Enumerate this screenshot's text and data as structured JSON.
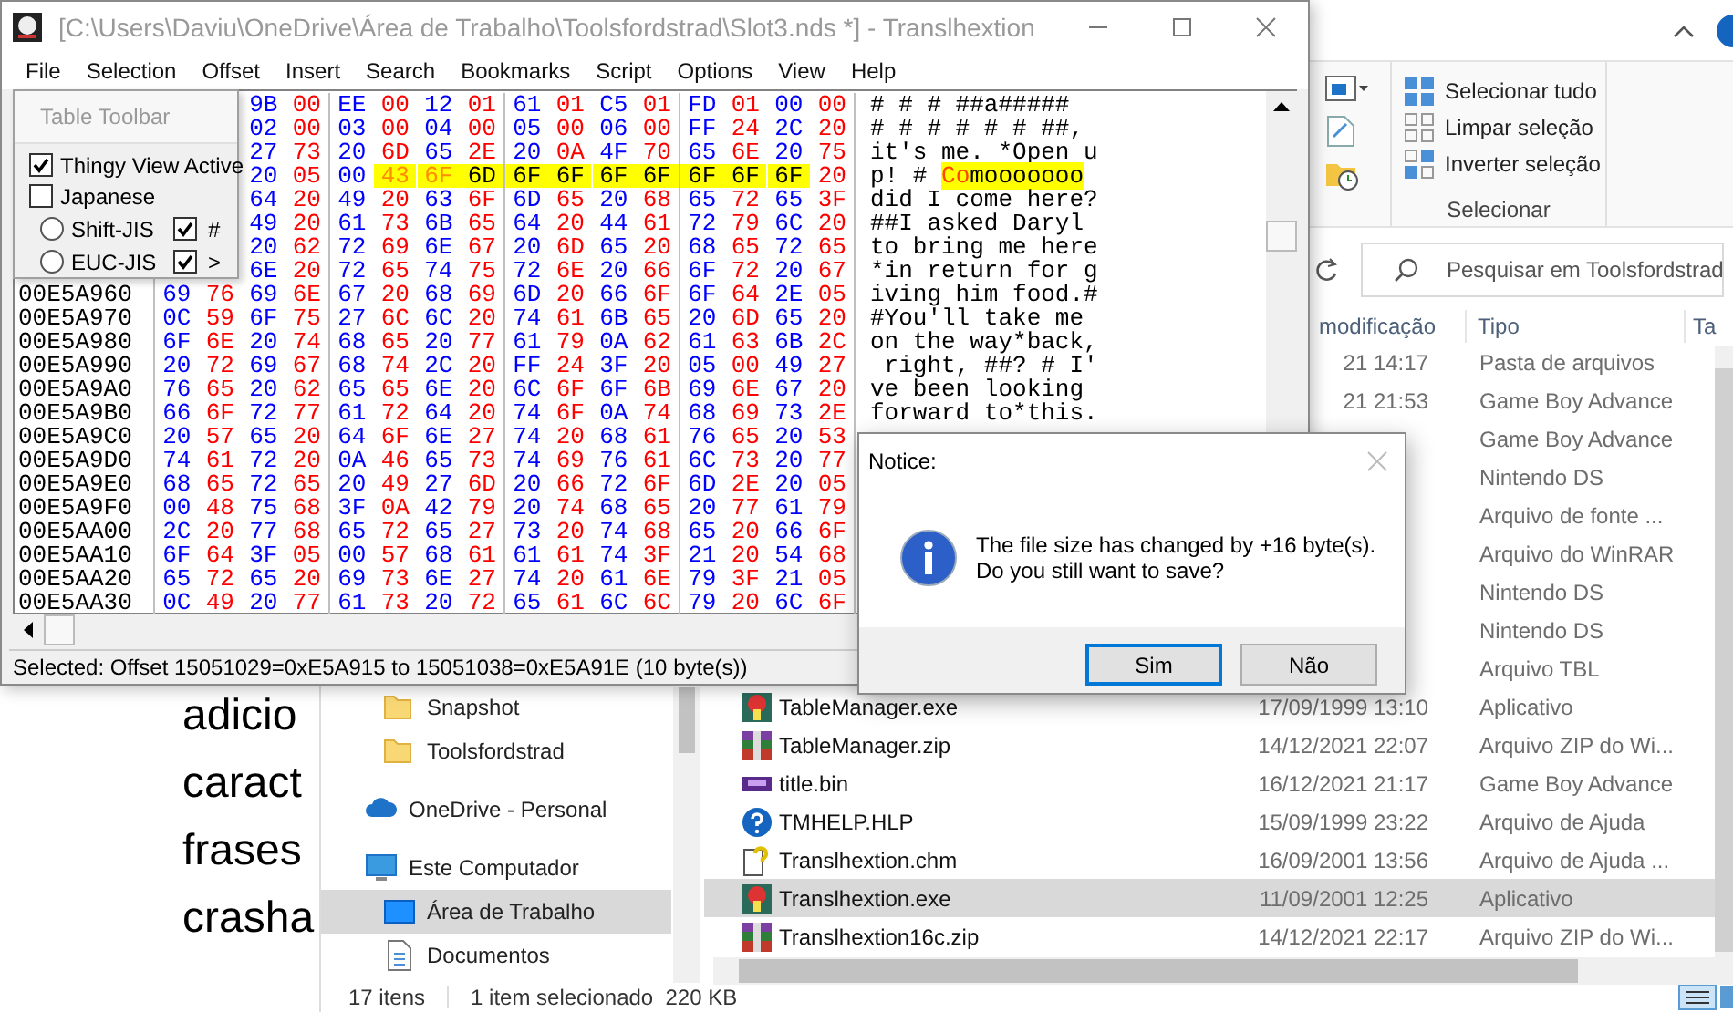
{
  "background_document": {
    "lines": [
      "adicio",
      "caract",
      "frases",
      "crasha"
    ]
  },
  "explorer": {
    "ribbon": {
      "select_group": {
        "items": [
          "Selecionar tudo",
          "Limpar seleção",
          "Inverter seleção"
        ],
        "label": "Selecionar"
      }
    },
    "search": {
      "placeholder": "Pesquisar em Toolsfordstrad"
    },
    "columns": [
      "modificação",
      "Tipo",
      "Ta"
    ],
    "files": [
      {
        "date": "21 14:17",
        "type": "Pasta de arquivos",
        "selected": false
      },
      {
        "date": "21 21:53",
        "type": "Game Boy Advance",
        "selected": false
      },
      {
        "type": "Game Boy Advance",
        "selected": false
      },
      {
        "type": "Nintendo DS",
        "selected": false
      },
      {
        "type": "Arquivo de fonte ...",
        "selected": false
      },
      {
        "type": "Arquivo do WinRAR",
        "selected": false
      },
      {
        "type": "Nintendo DS",
        "selected": false
      },
      {
        "type": "Nintendo DS",
        "selected": false
      },
      {
        "type": "Arquivo TBL",
        "selected": false
      },
      {
        "kind": "app",
        "name": "TableManager.exe",
        "date": "17/09/1999 13:10",
        "type": "Aplicativo",
        "selected": false
      },
      {
        "kind": "zip",
        "name": "TableManager.zip",
        "date": "14/12/2021 22:07",
        "type": "Arquivo ZIP do Wi...",
        "selected": false
      },
      {
        "kind": "rom",
        "name": "title.bin",
        "date": "16/12/2021 21:17",
        "type": "Game Boy Advance",
        "selected": false
      },
      {
        "kind": "help",
        "name": "TMHELP.HLP",
        "date": "15/09/1999 23:22",
        "type": "Arquivo de Ajuda",
        "selected": false
      },
      {
        "kind": "chm",
        "name": "Translhextion.chm",
        "date": "16/09/2001 13:56",
        "type": "Arquivo de Ajuda ...",
        "selected": false
      },
      {
        "kind": "app",
        "name": "Translhextion.exe",
        "date": "11/09/2001 12:25",
        "type": "Aplicativo",
        "selected": true
      },
      {
        "kind": "zip",
        "name": "Translhextion16c.zip",
        "date": "14/12/2021 22:17",
        "type": "Arquivo ZIP do Wi...",
        "selected": false
      }
    ],
    "nav": [
      {
        "kind": "folder",
        "label": "Snapshot",
        "selected": false
      },
      {
        "kind": "folder",
        "label": "Toolsfordstrad",
        "selected": false
      },
      {
        "kind": "cloud",
        "label": "OneDrive - Personal",
        "selected": false
      },
      {
        "kind": "computer",
        "label": "Este Computador",
        "selected": false
      },
      {
        "kind": "desktop",
        "label": "Área de Trabalho",
        "selected": true
      },
      {
        "kind": "documents",
        "label": "Documentos",
        "selected": false
      }
    ],
    "status": [
      "17 itens",
      "1 item selecionado  220 KB"
    ]
  },
  "editor": {
    "title": "[C:\\Users\\Daviu\\OneDrive\\Área de Trabalho\\Toolsfordstrad\\Slot3.nds *] - Translhextion",
    "menu": [
      "File",
      "Selection",
      "Offset",
      "Insert",
      "Search",
      "Bookmarks",
      "Script",
      "Options",
      "View",
      "Help"
    ],
    "table_toolbar": {
      "title": "Table Toolbar",
      "options": [
        {
          "kind": "checkbox",
          "label": "Thingy View Active",
          "checked": true
        },
        {
          "kind": "checkbox",
          "label": "Japanese",
          "checked": false
        },
        {
          "kind": "radio",
          "label": "Shift-JIS",
          "selected": false,
          "flag": {
            "label": "#",
            "checked": true
          }
        },
        {
          "kind": "radio",
          "label": "EUC-JIS",
          "selected": false,
          "flag": {
            "label": ">",
            "checked": true
          }
        }
      ]
    },
    "rows": [
      {
        "bytes": [
          "9B",
          "00",
          "EE",
          "00",
          "12",
          "01",
          "61",
          "01",
          "C5",
          "01",
          "FD",
          "01",
          "00",
          "00"
        ],
        "text": "# # # ##a#####"
      },
      {
        "bytes": [
          "02",
          "00",
          "03",
          "00",
          "04",
          "00",
          "05",
          "00",
          "06",
          "00",
          "FF",
          "24",
          "2C",
          "20"
        ],
        "text": "# # # # # # ##,"
      },
      {
        "bytes": [
          "27",
          "73",
          "20",
          "6D",
          "65",
          "2E",
          "20",
          "0A",
          "4F",
          "70",
          "65",
          "6E",
          "20",
          "75"
        ],
        "text": "it's me. *Open u"
      },
      {
        "bytes": [
          "20",
          "05",
          "00",
          {
            "hex": "43",
            "selected": true,
            "modified": true
          },
          {
            "hex": "6F",
            "selected": true,
            "modified": true
          },
          {
            "hex": "6D",
            "selected": true,
            "modified": false
          },
          {
            "hex": "6F",
            "selected": true,
            "modified": false
          },
          {
            "hex": "6F",
            "selected": true,
            "modified": false
          },
          {
            "hex": "6F",
            "selected": true,
            "modified": false
          },
          {
            "hex": "6F",
            "selected": true,
            "modified": false
          },
          {
            "hex": "6F",
            "selected": true,
            "modified": false
          },
          {
            "hex": "6F",
            "selected": true,
            "modified": false
          },
          {
            "hex": "6F",
            "selected": true,
            "modified": false
          },
          "20"
        ],
        "text": [
          {
            "text": "p! # ",
            "selected": false,
            "modified": false
          },
          {
            "text": "Co",
            "selected": true,
            "modified": true
          },
          {
            "text": "mooooooo",
            "selected": true,
            "modified": false
          }
        ]
      },
      {
        "bytes": [
          "64",
          "20",
          "49",
          "20",
          "63",
          "6F",
          "6D",
          "65",
          "20",
          "68",
          "65",
          "72",
          "65",
          "3F"
        ],
        "text": "did I come here?"
      },
      {
        "bytes": [
          "49",
          "20",
          "61",
          "73",
          "6B",
          "65",
          "64",
          "20",
          "44",
          "61",
          "72",
          "79",
          "6C",
          "20"
        ],
        "text": "##I asked Daryl"
      },
      {
        "bytes": [
          "20",
          "62",
          "72",
          "69",
          "6E",
          "67",
          "20",
          "6D",
          "65",
          "20",
          "68",
          "65",
          "72",
          "65"
        ],
        "text": "to bring me here"
      },
      {
        "bytes": [
          "6E",
          "20",
          "72",
          "65",
          "74",
          "75",
          "72",
          "6E",
          "20",
          "66",
          "6F",
          "72",
          "20",
          "67"
        ],
        "text": "*in return for g"
      },
      {
        "offset": "00E5A960",
        "bytes": [
          "69",
          "76",
          "69",
          "6E",
          "67",
          "20",
          "68",
          "69",
          "6D",
          "20",
          "66",
          "6F",
          "6F",
          "64",
          "2E",
          "05"
        ],
        "text": "iving him food.#"
      },
      {
        "offset": "00E5A970",
        "bytes": [
          "0C",
          "59",
          "6F",
          "75",
          "27",
          "6C",
          "6C",
          "20",
          "74",
          "61",
          "6B",
          "65",
          "20",
          "6D",
          "65",
          "20"
        ],
        "text": "#You'll take me"
      },
      {
        "offset": "00E5A980",
        "bytes": [
          "6F",
          "6E",
          "20",
          "74",
          "68",
          "65",
          "20",
          "77",
          "61",
          "79",
          "0A",
          "62",
          "61",
          "63",
          "6B",
          "2C"
        ],
        "text": "on the way*back,"
      },
      {
        "offset": "00E5A990",
        "bytes": [
          "20",
          "72",
          "69",
          "67",
          "68",
          "74",
          "2C",
          "20",
          "FF",
          "24",
          "3F",
          "20",
          "05",
          "00",
          "49",
          "27"
        ],
        "text": " right, ##? # I'"
      },
      {
        "offset": "00E5A9A0",
        "bytes": [
          "76",
          "65",
          "20",
          "62",
          "65",
          "65",
          "6E",
          "20",
          "6C",
          "6F",
          "6F",
          "6B",
          "69",
          "6E",
          "67",
          "20"
        ],
        "text": "ve been looking"
      },
      {
        "offset": "00E5A9B0",
        "bytes": [
          "66",
          "6F",
          "72",
          "77",
          "61",
          "72",
          "64",
          "20",
          "74",
          "6F",
          "0A",
          "74",
          "68",
          "69",
          "73",
          "2E"
        ],
        "text": "forward to*this."
      },
      {
        "offset": "00E5A9C0",
        "bytes": [
          "20",
          "57",
          "65",
          "20",
          "64",
          "6F",
          "6E",
          "27",
          "74",
          "20",
          "68",
          "61",
          "76",
          "65",
          "20",
          "53"
        ]
      },
      {
        "offset": "00E5A9D0",
        "bytes": [
          "74",
          "61",
          "72",
          "20",
          "0A",
          "46",
          "65",
          "73",
          "74",
          "69",
          "76",
          "61",
          "6C",
          "73",
          "20",
          "77"
        ]
      },
      {
        "offset": "00E5A9E0",
        "bytes": [
          "68",
          "65",
          "72",
          "65",
          "20",
          "49",
          "27",
          "6D",
          "20",
          "66",
          "72",
          "6F",
          "6D",
          "2E",
          "20",
          "05"
        ]
      },
      {
        "offset": "00E5A9F0",
        "bytes": [
          "00",
          "48",
          "75",
          "68",
          "3F",
          "0A",
          "42",
          "79",
          "20",
          "74",
          "68",
          "65",
          "20",
          "77",
          "61",
          "79"
        ]
      },
      {
        "offset": "00E5AA00",
        "bytes": [
          "2C",
          "20",
          "77",
          "68",
          "65",
          "72",
          "65",
          "27",
          "73",
          "20",
          "74",
          "68",
          "65",
          "20",
          "66",
          "6F"
        ]
      },
      {
        "offset": "00E5AA10",
        "bytes": [
          "6F",
          "64",
          "3F",
          "05",
          "00",
          "57",
          "68",
          "61",
          "61",
          "61",
          "74",
          "3F",
          "21",
          "20",
          "54",
          "68"
        ]
      },
      {
        "offset": "00E5AA20",
        "bytes": [
          "65",
          "72",
          "65",
          "20",
          "69",
          "73",
          "6E",
          "27",
          "74",
          "20",
          "61",
          "6E",
          "79",
          "3F",
          "21",
          "05"
        ]
      },
      {
        "offset": "00E5AA30",
        "bytes": [
          "0C",
          "49",
          "20",
          "77",
          "61",
          "73",
          "20",
          "72",
          "65",
          "61",
          "6C",
          "6C",
          "79",
          "20",
          "6C",
          "6F"
        ]
      }
    ],
    "status": "Selected: Offset 15051029=0xE5A915 to 15051038=0xE5A91E (10 byte(s))"
  },
  "dialog": {
    "title": "Notice:",
    "message": "The file size has changed by +16 byte(s).\nDo you still want to save?",
    "buttons": [
      {
        "label": "Sim",
        "default": true
      },
      {
        "label": "Não",
        "default": false
      }
    ]
  }
}
